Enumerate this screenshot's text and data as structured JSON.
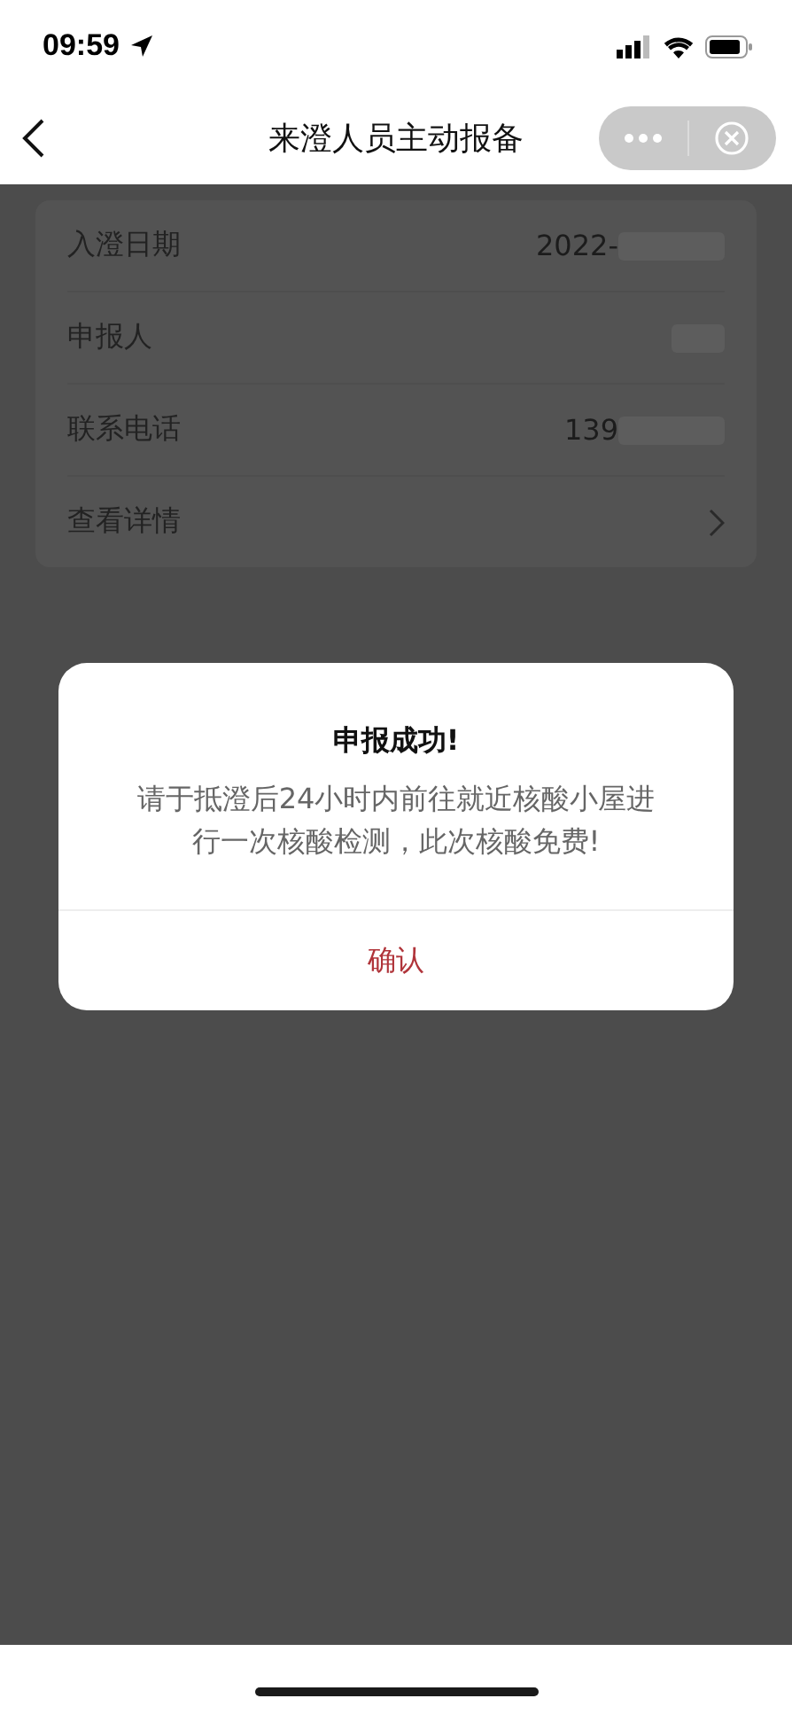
{
  "status_bar": {
    "time": "09:59"
  },
  "nav_bar": {
    "title": "来澄人员主动报备"
  },
  "info_rows": [
    {
      "kind": "value",
      "label": "入澄日期",
      "value": "2022-",
      "redacted": true
    },
    {
      "kind": "value",
      "label": "申报人",
      "redacted": true
    },
    {
      "kind": "value",
      "label": "联系电话",
      "value": "139",
      "redacted": true
    },
    {
      "kind": "link",
      "label": "查看详情"
    }
  ],
  "dialog": {
    "title": "申报成功!",
    "message": "请于抵澄后24小时内前往就近核酸小屋进行一次核酸检测，此次核酸免费!",
    "button": "确认"
  }
}
